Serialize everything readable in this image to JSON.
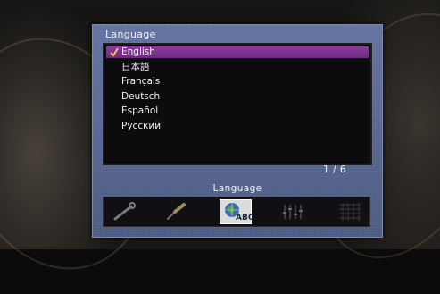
{
  "panel": {
    "title": "Language",
    "items": [
      {
        "label": "English",
        "selected": true
      },
      {
        "label": "日本語",
        "selected": false
      },
      {
        "label": "Français",
        "selected": false
      },
      {
        "label": "Deutsch",
        "selected": false
      },
      {
        "label": "Español",
        "selected": false
      },
      {
        "label": "Русский",
        "selected": false
      }
    ],
    "page_counter": "1 / 6",
    "menu_label": "Language",
    "menu_icons": [
      {
        "name": "wrench-icon",
        "active": false
      },
      {
        "name": "screwdriver-icon",
        "active": false
      },
      {
        "name": "globe-abc-icon",
        "active": true,
        "text": "ABC"
      },
      {
        "name": "equalizer-icon",
        "active": false
      },
      {
        "name": "grid-icon",
        "active": false
      }
    ]
  },
  "colors": {
    "panel": "#5a6a8d",
    "selection": "#7b2f8c",
    "list_bg": "#0c0c0e"
  }
}
